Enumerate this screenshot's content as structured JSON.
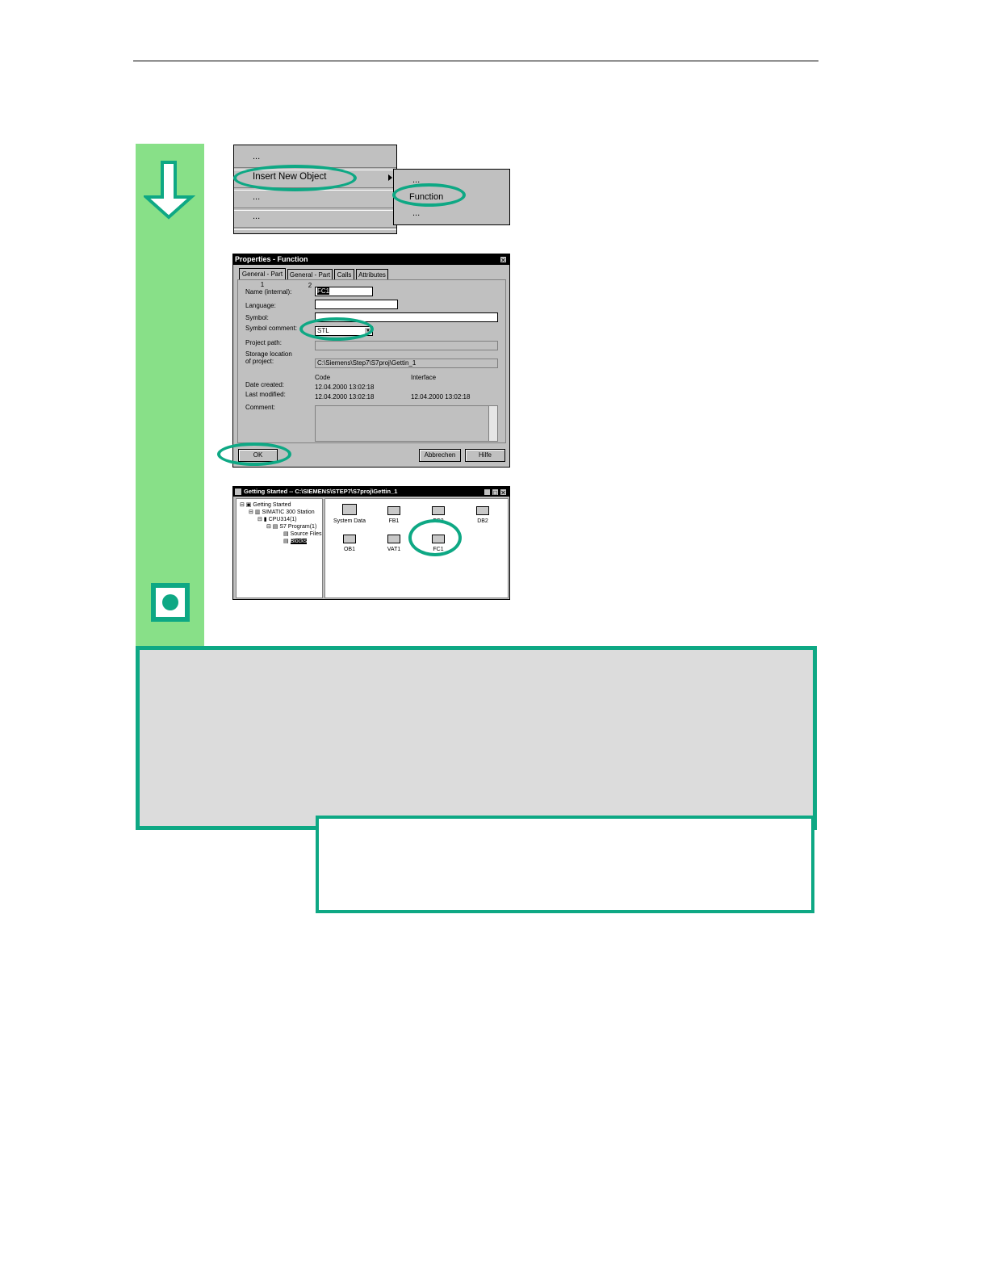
{
  "menu": {
    "items": [
      "...",
      "Insert New Object",
      "...",
      "..."
    ],
    "submenu": [
      "...",
      "Function",
      "..."
    ]
  },
  "dialog": {
    "title": "Properties - Function",
    "tabs": [
      "General - Part 1",
      "General - Part 2",
      "Calls",
      "Attributes"
    ],
    "labels": {
      "name": "Name (internal):",
      "language": "Language:",
      "symbol": "Symbol:",
      "symbol_comment": "Symbol comment:",
      "project_path": "Project path:",
      "storage1": "Storage location",
      "storage2": "of project:",
      "date_created": "Date created:",
      "last_modified": "Last modified:",
      "comment": "Comment:",
      "code": "Code",
      "interface": "Interface"
    },
    "values": {
      "name": "FC1",
      "symbol_comment": "STL",
      "storage": "C:\\Siemens\\Step7\\S7proj\\Gettin_1",
      "created_code": "12.04.2000  13:02:18",
      "modified_code": "12.04.2000  13:02:18",
      "modified_interface": "12.04.2000  13:02:18"
    },
    "buttons": {
      "ok": "OK",
      "cancel": "Abbrechen",
      "help": "Hilfe"
    }
  },
  "explorer": {
    "title": "Getting Started -- C:\\SIEMENS\\STEP7\\S7proj\\Gettin_1",
    "tree": [
      "Getting Started",
      "SIMATIC 300 Station",
      "CPU314(1)",
      "S7 Program(1)",
      "Source Files",
      "Blocks"
    ],
    "blocks": [
      "System Data",
      "FB1",
      "FC2",
      "DB2",
      "OB1",
      "VAT1",
      "FC1"
    ]
  },
  "colors": {
    "accent": "#0ea884",
    "green_bar": "#88e088",
    "gray_box": "#dcdcdc"
  }
}
